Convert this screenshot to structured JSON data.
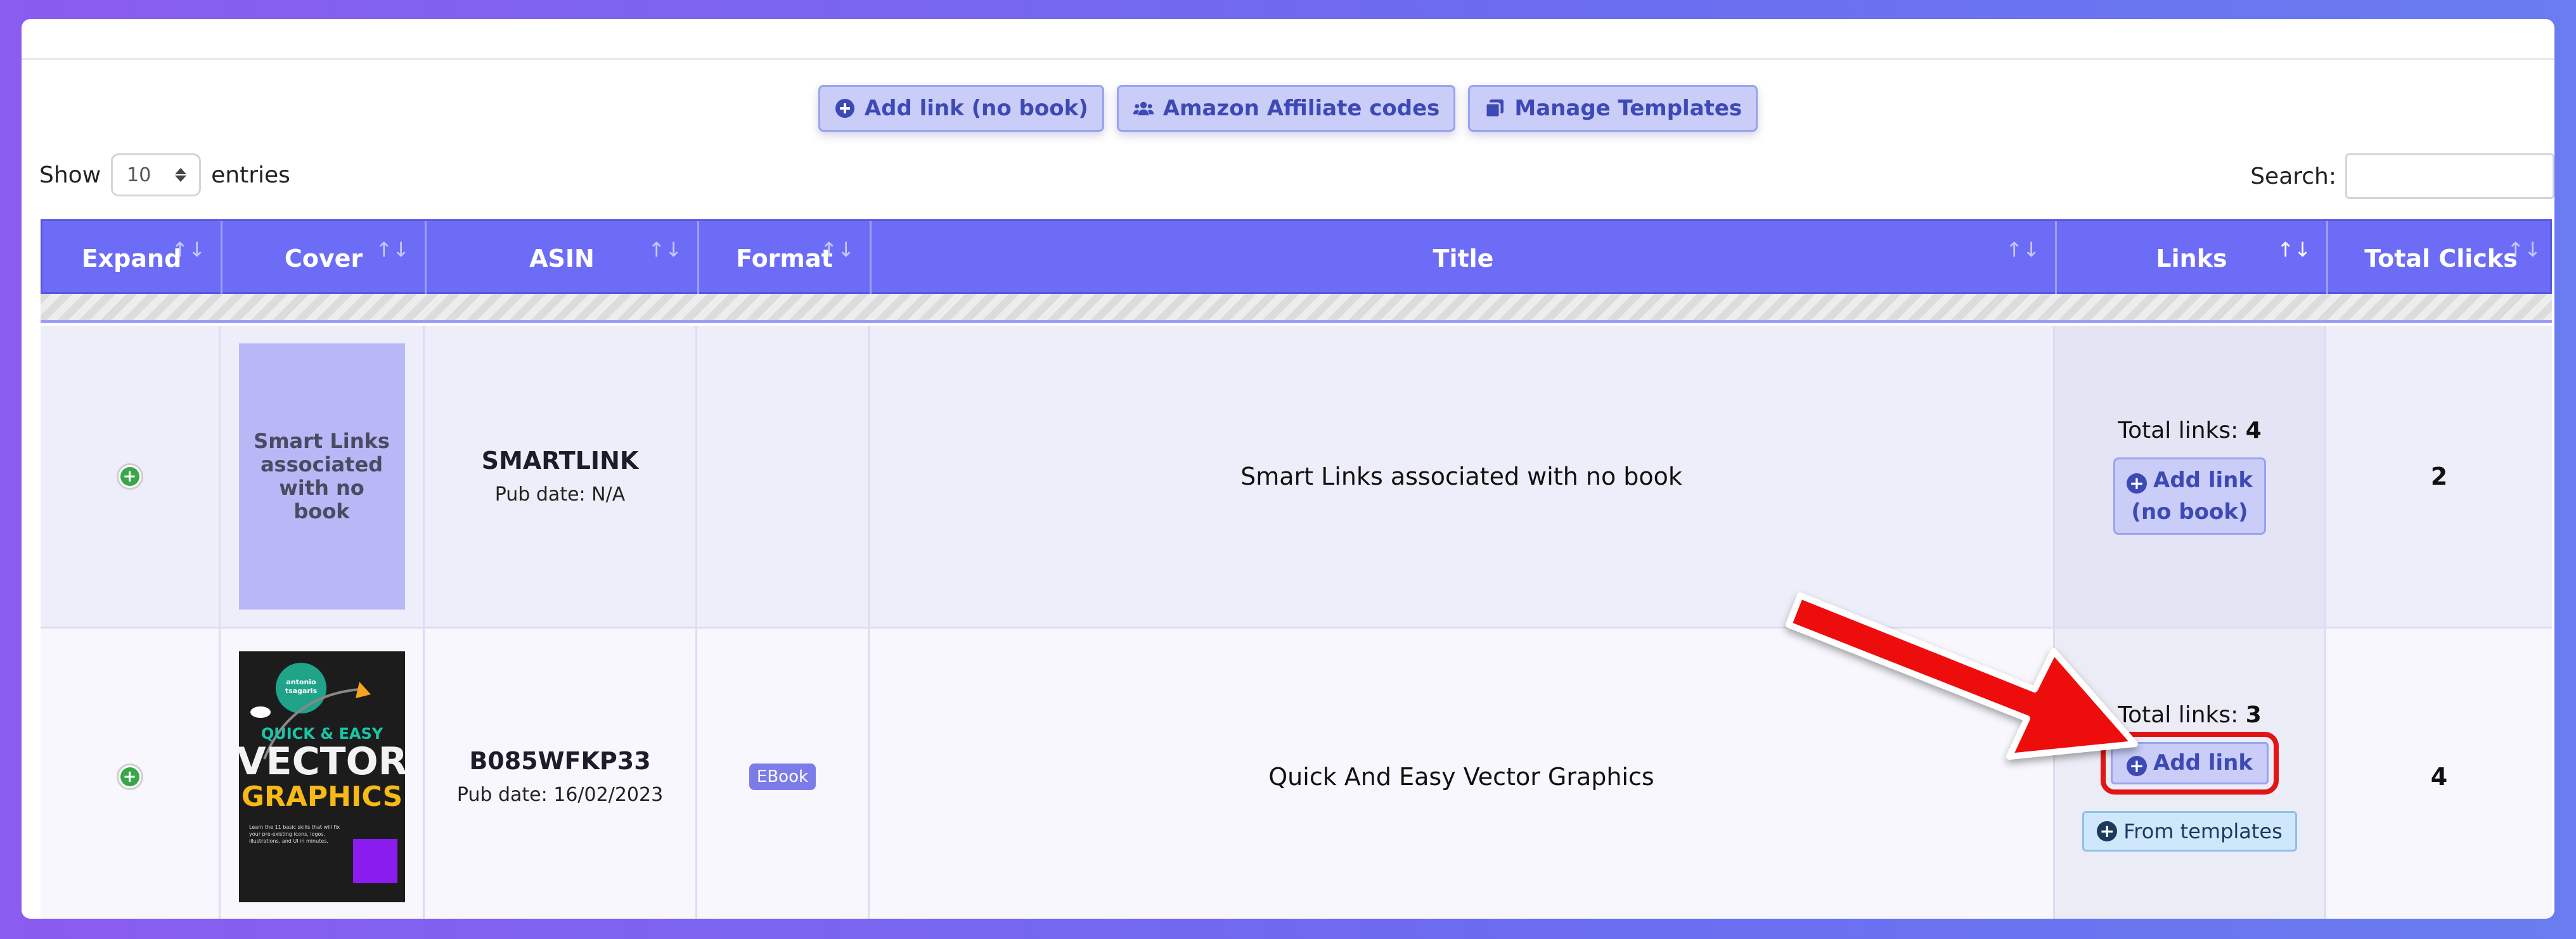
{
  "toolbar": {
    "add_link_no_book": "Add link (no book)",
    "amazon_codes": "Amazon Affiliate codes",
    "manage_templates": "Manage Templates"
  },
  "length": {
    "show_label": "Show",
    "value": "10",
    "entries_label": "entries"
  },
  "search": {
    "label": "Search:",
    "value": ""
  },
  "table": {
    "headers": [
      "Expand",
      "Cover",
      "ASIN",
      "Format",
      "Title",
      "Links",
      "Total Clicks"
    ],
    "sort_icons": [
      "↑↓",
      "↑↓",
      "↑↓",
      "↑↓",
      "↑↓",
      "↑↓",
      "↑↓"
    ],
    "rows": [
      {
        "cover_text": "Smart Links associated with no book",
        "asin": "SMARTLINK",
        "pub_date": "Pub date: N/A",
        "format": "",
        "title": "Smart Links associated with no book",
        "total_links_label": "Total links:",
        "total_links": "4",
        "add_link_line1": "Add link",
        "add_link_line2": "(no book)",
        "total_clicks": "2"
      },
      {
        "cover_author": "antonio\ntsagaris",
        "cover_line1": "QUICK & EASY",
        "cover_line2": "VECTOR",
        "cover_line3": "GRAPHICS",
        "cover_blurb": "Learn the 11 basic skills that will fix your pre-existing icons, logos, illustrations, and UI in minutes.",
        "asin": "B085WFKP33",
        "pub_date": "Pub date: 16/02/2023",
        "format": "EBook",
        "title": "Quick And Easy Vector Graphics",
        "total_links_label": "Total links:",
        "total_links": "3",
        "add_link": "Add link",
        "from_templates": "From templates",
        "total_clicks": "4"
      }
    ]
  },
  "colors": {
    "header": "#6c6cf7",
    "button": "#c9cdf7",
    "highlight": "#e01515"
  }
}
